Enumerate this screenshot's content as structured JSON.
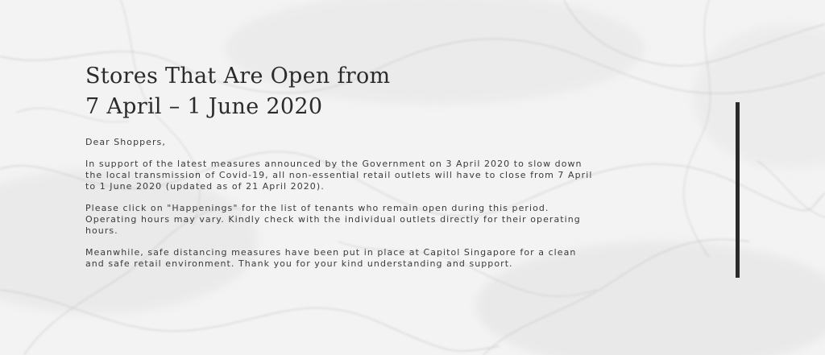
{
  "page": {
    "title_line1": "Stores That Are Open from",
    "title_line2": "7 April – 1 June 2020",
    "greeting": "Dear Shoppers,",
    "paragraph1": "In support of the latest measures announced by the Government on 3 April 2020 to slow down the local transmission of Covid-19, all non-essential retail outlets will have to close from 7 April to 1 June 2020 (updated as of 21 April 2020).",
    "paragraph2": "Please click on \"Happenings\" for the list of tenants who remain open during this period. Operating hours may vary. Kindly check with the individual outlets directly for their operating hours.",
    "paragraph3": "Meanwhile, safe distancing measures have been put in place at Capitol Singapore for a clean and safe retail environment. Thank you for your kind understanding and support."
  },
  "colors": {
    "background": "#f2f2f2",
    "heading": "#2b2b2b",
    "body": "#3a3a3a",
    "accent_bar": "#2a2a2a"
  }
}
